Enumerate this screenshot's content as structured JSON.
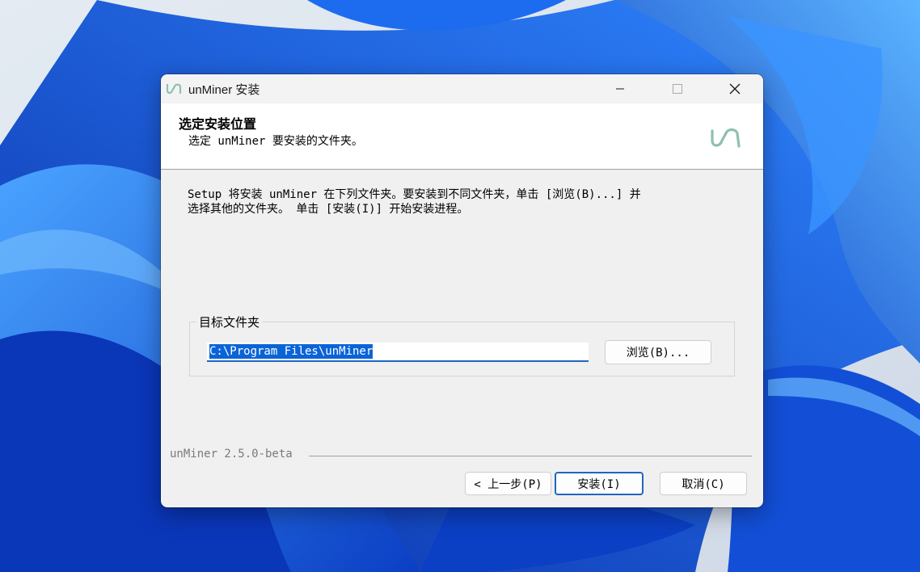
{
  "window": {
    "title": "unMiner 安装"
  },
  "header": {
    "title": "选定安装位置",
    "subtitle": "选定 unMiner 要安装的文件夹。"
  },
  "body": {
    "line1": "Setup 将安装 unMiner 在下列文件夹。要安装到不同文件夹，单击 [浏览(B)...] 并",
    "line2": "选择其他的文件夹。 单击 [安装(I)] 开始安装进程。"
  },
  "destination": {
    "group_label": "目标文件夹",
    "path_value": "C:\\Program Files\\unMiner",
    "browse_label": "浏览(B)..."
  },
  "footer": {
    "version": "unMiner 2.5.0-beta",
    "back_label": "< 上一步(P)",
    "install_label": "安装(I)",
    "cancel_label": "取消(C)"
  },
  "colors": {
    "accent": "#1f66c2",
    "selection": "#0a64d8",
    "logo": "#8fbfb0",
    "wallpaper": "#1e5fe0"
  }
}
